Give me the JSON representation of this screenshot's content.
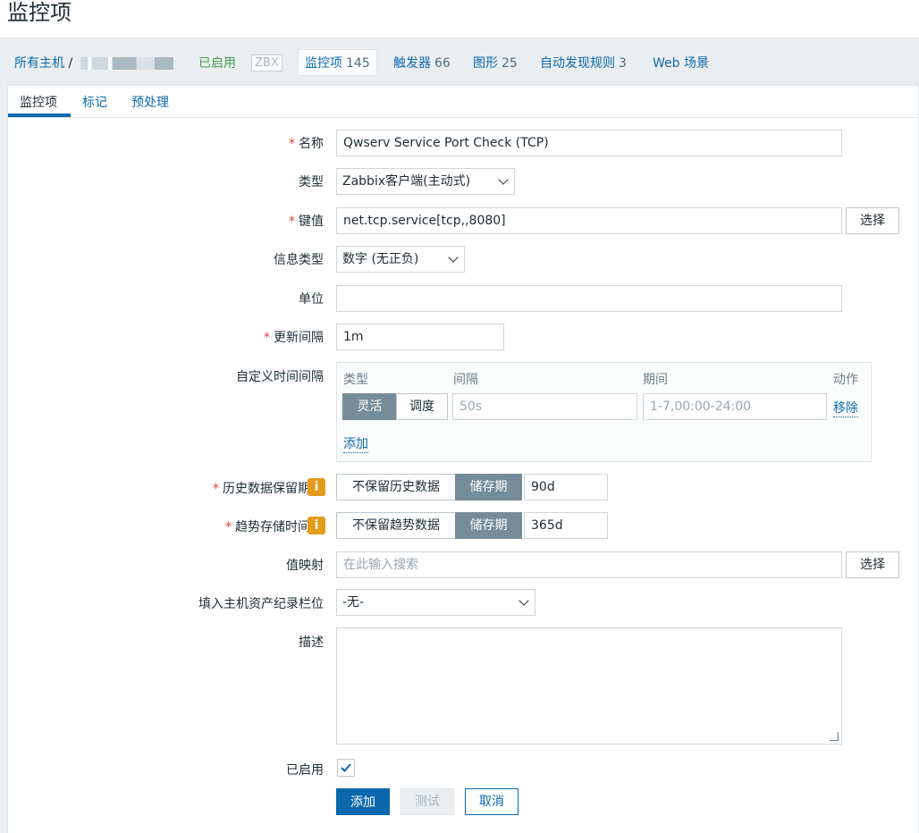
{
  "page_title": "监控项",
  "host_nav": {
    "all_hosts": "所有主机",
    "separator": "/",
    "enabled_status": "已启用",
    "zbx_badge": "ZBX",
    "items_label": "监控项",
    "items_count": "145",
    "triggers_label": "触发器",
    "triggers_count": "66",
    "graphs_label": "图形",
    "graphs_count": "25",
    "discovery_label": "自动发现规则",
    "discovery_count": "3",
    "web_label": "Web 场景"
  },
  "tabs": [
    "监控项",
    "标记",
    "预处理"
  ],
  "form": {
    "name_label": "名称",
    "name_value": "Qwserv Service Port Check (TCP)",
    "type_label": "类型",
    "type_value": "Zabbix客户端(主动式)",
    "key_label": "键值",
    "key_value": "net.tcp.service[tcp,,8080]",
    "select_btn": "选择",
    "info_type_label": "信息类型",
    "info_type_value": "数字 (无正负)",
    "units_label": "单位",
    "units_value": "",
    "interval_label": "更新间隔",
    "interval_value": "1m",
    "custom_intervals_label": "自定义时间间隔",
    "custom_intervals": {
      "col_type": "类型",
      "col_interval": "间隔",
      "col_period": "期间",
      "col_action": "动作",
      "flexible": "灵活",
      "scheduling": "调度",
      "interval_placeholder": "50s",
      "period_placeholder": "1-7,00:00-24:00",
      "remove": "移除",
      "add": "添加"
    },
    "history_label": "历史数据保留期",
    "history_off": "不保留历史数据",
    "history_on": "储存期",
    "history_value": "90d",
    "trends_label": "趋势存储时间",
    "trends_off": "不保留趋势数据",
    "trends_on": "储存期",
    "trends_value": "365d",
    "valuemap_label": "值映射",
    "valuemap_placeholder": "在此输入搜索",
    "inventory_label": "填入主机资产纪录栏位",
    "inventory_value": "-无-",
    "description_label": "描述",
    "enabled_label": "已启用",
    "enabled_checked": true,
    "add_btn": "添加",
    "test_btn": "测试",
    "cancel_btn": "取消"
  }
}
